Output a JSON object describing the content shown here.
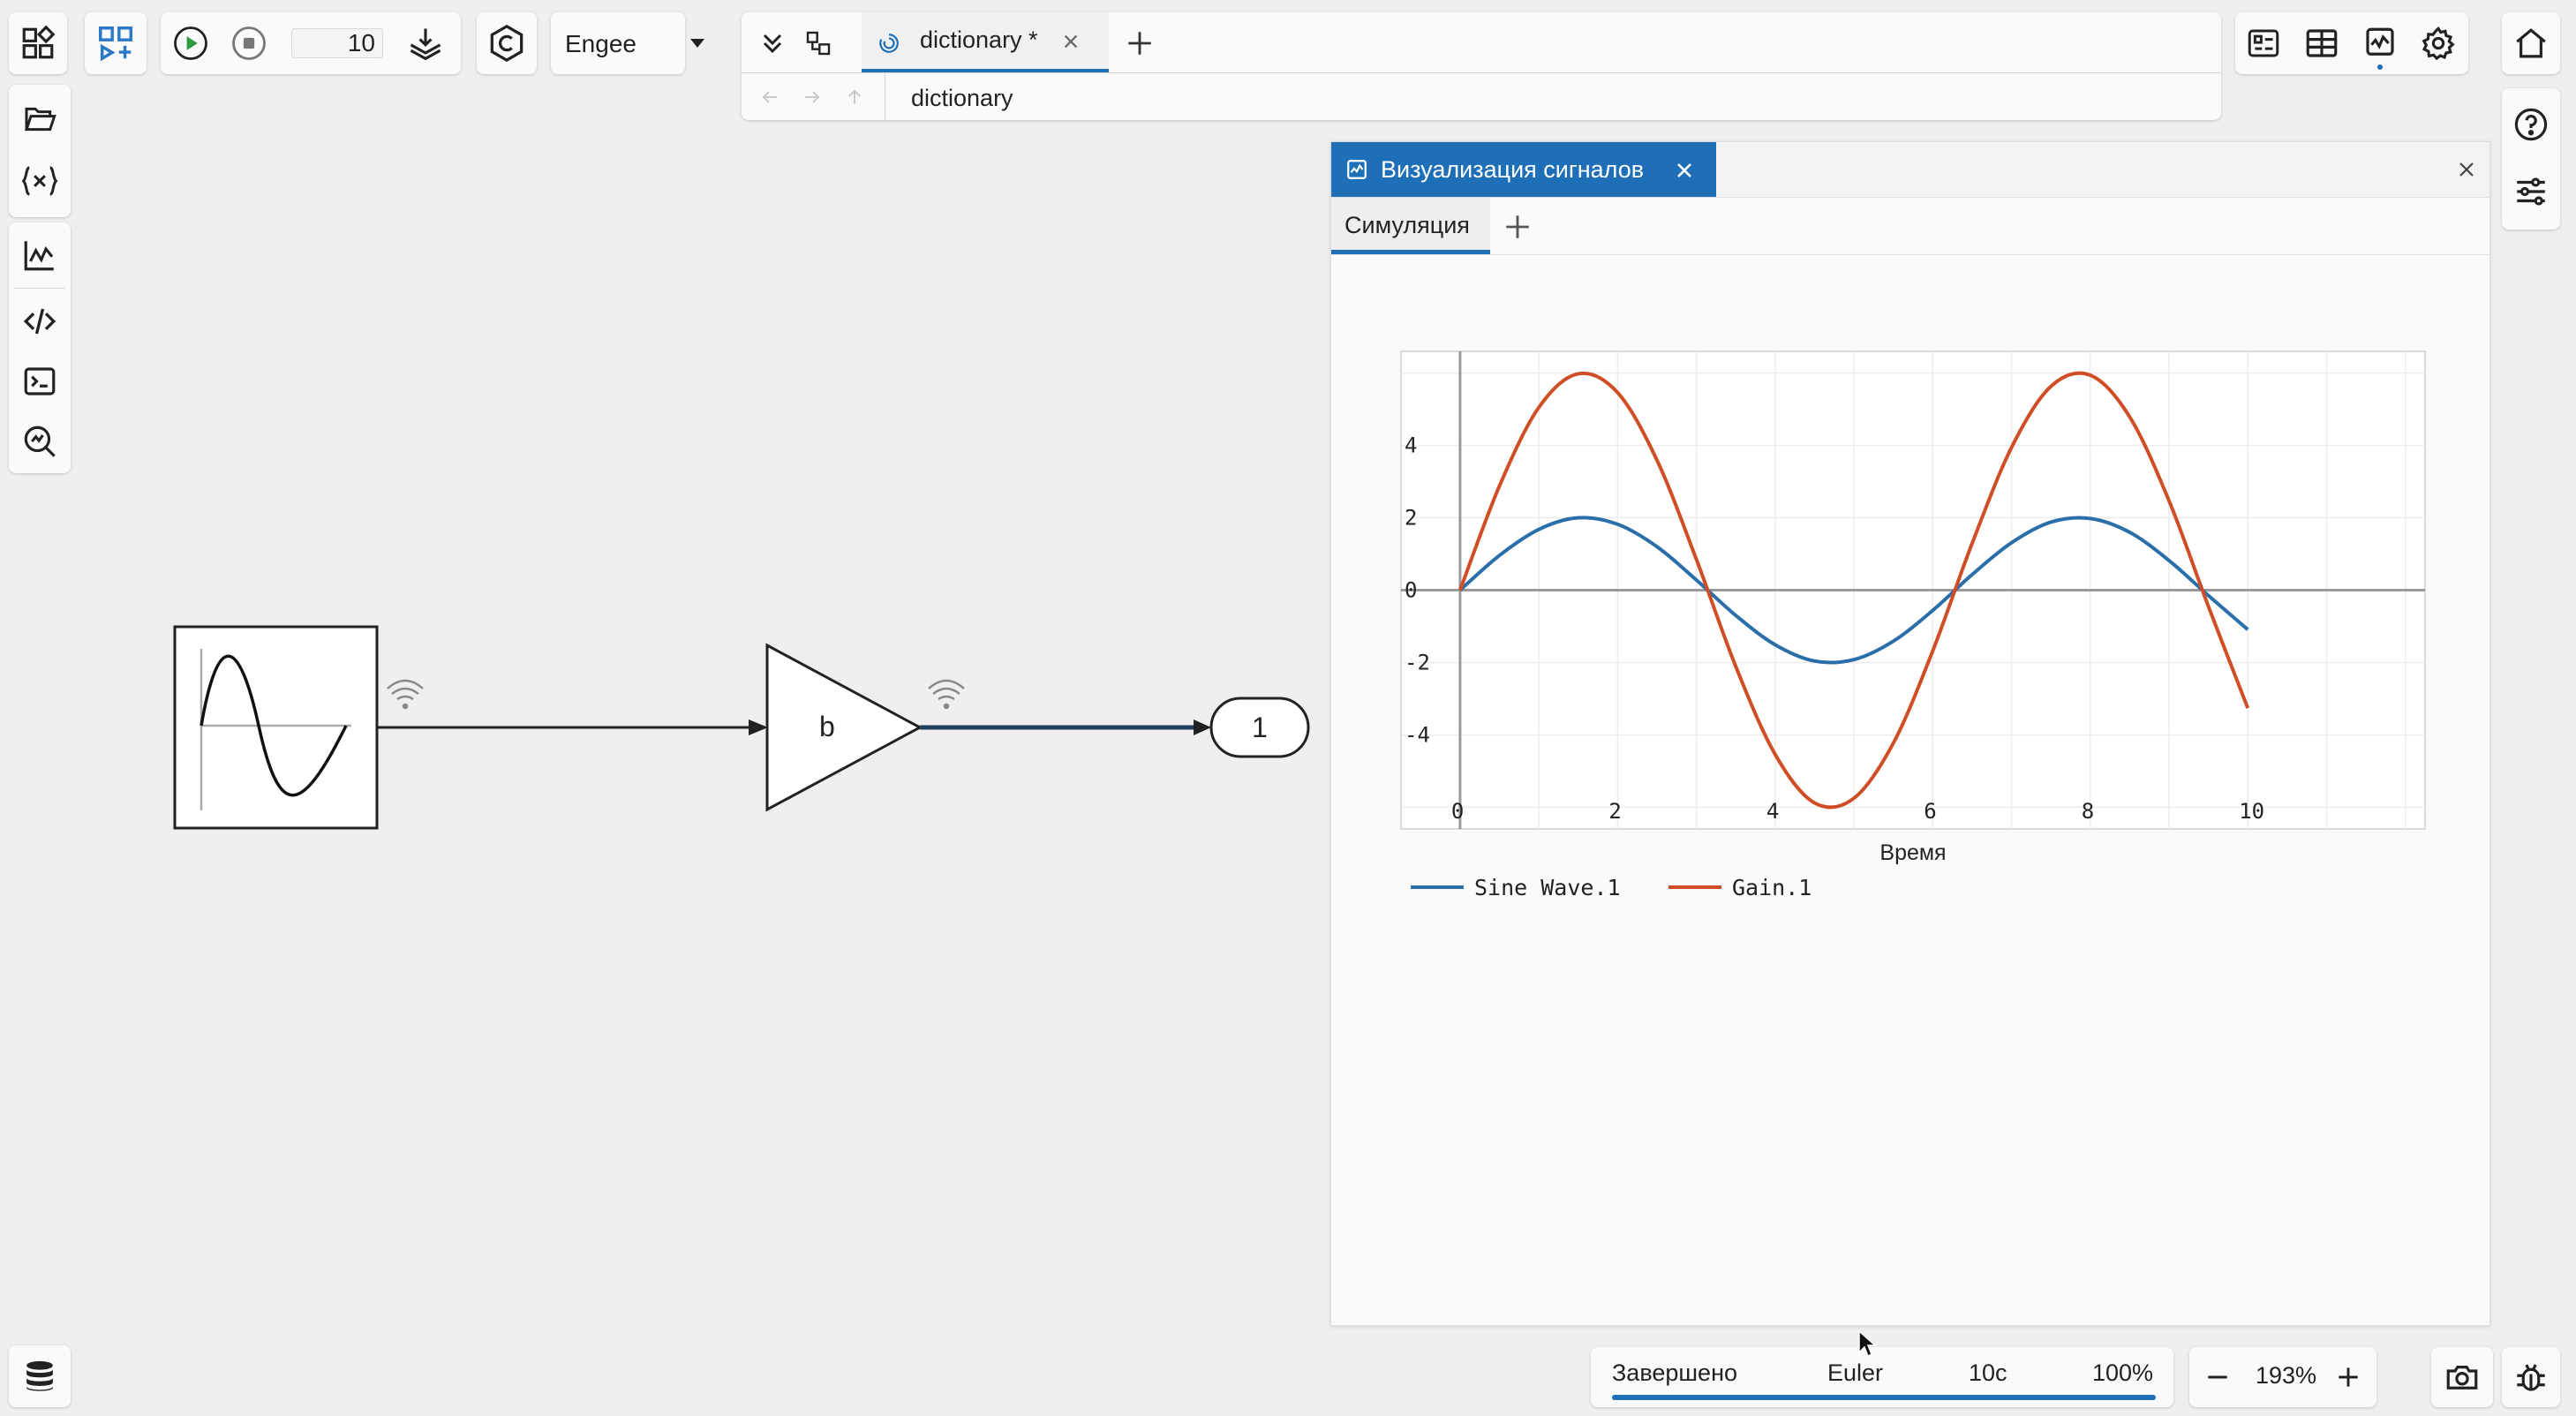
{
  "toolbar": {
    "sim_time_value": "10",
    "solver_select": "Engee",
    "document_tab": "dictionary *",
    "breadcrumb": "dictionary"
  },
  "signal_panel": {
    "title": "Визуализация сигналов",
    "tabs": [
      {
        "label": "Симуляция"
      }
    ]
  },
  "canvas": {
    "gain_label": "b",
    "outport_label": "1"
  },
  "statusbar": {
    "status": "Завершено",
    "solver": "Euler",
    "time": "10c",
    "progress_text": "100%",
    "progress": 1.0,
    "zoom": "193%"
  },
  "colors": {
    "accent": "#1e6fb8",
    "sine": "#2a6faa",
    "gain": "#d04e26"
  },
  "chart_data": {
    "type": "line",
    "xlabel": "Время",
    "ylabel": "",
    "xlim": [
      -0.75,
      12.25
    ],
    "ylim": [
      -6.6,
      6.6
    ],
    "xticks": [
      0,
      2,
      4,
      6,
      8,
      10
    ],
    "yticks": [
      4,
      2,
      0,
      -2,
      -4
    ],
    "grid": true,
    "legend": "bottom-left",
    "x": [
      0,
      0.5,
      1,
      1.5,
      2,
      2.5,
      3,
      3.5,
      4,
      4.5,
      5,
      5.5,
      6,
      6.5,
      7,
      7.5,
      8,
      8.5,
      9,
      9.5,
      10
    ],
    "series": [
      {
        "name": "Sine Wave.1",
        "color": "#2a6faa",
        "values": [
          0,
          0.96,
          1.68,
          2.0,
          1.82,
          1.2,
          0.28,
          -0.7,
          -1.51,
          -1.96,
          -1.92,
          -1.41,
          -0.56,
          0.43,
          1.31,
          1.88,
          1.98,
          1.6,
          0.82,
          -0.15,
          -1.09
        ]
      },
      {
        "name": "Gain.1",
        "color": "#d04e26",
        "values": [
          0,
          2.88,
          5.05,
          5.98,
          5.46,
          3.59,
          0.85,
          -2.11,
          -4.54,
          -5.88,
          -5.75,
          -4.23,
          -1.68,
          1.29,
          3.94,
          5.63,
          5.94,
          4.79,
          2.47,
          -0.45,
          -3.26
        ]
      }
    ]
  }
}
